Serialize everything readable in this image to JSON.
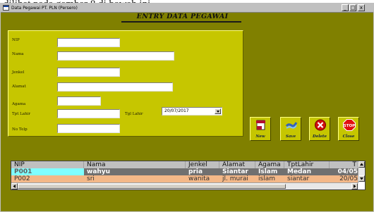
{
  "caption": "dilihat pada gambar 8 di bawah ini.",
  "window": {
    "title": "Data Pegawai PT. PLN (Persero)",
    "min_label": "_",
    "max_label": "□",
    "close_label": "x"
  },
  "form": {
    "title": "ENTRY DATA PEGAWAI",
    "labels": {
      "nip": "NIP",
      "nama": "Nama",
      "jenkel": "Jenkel",
      "alamat": "Alamat",
      "agama": "Agama",
      "tpt_lahir": "Tpt Lahir",
      "tgl_lahir": "Tgl Lahir",
      "no_telp": "No Telp"
    },
    "values": {
      "nip": "",
      "nama": "",
      "jenkel": "",
      "alamat": "",
      "agama": "",
      "tpt_lahir": "",
      "tgl_lahir": "20/07/2017",
      "no_telp": ""
    }
  },
  "toolbar": {
    "new_label": "New",
    "save_label": "Save",
    "delete_label": "Delete",
    "close_label": "Close",
    "colors": {
      "new": "#b01030",
      "save": "#3060c0",
      "delete": "#d01010",
      "close": "#e01010"
    }
  },
  "grid": {
    "columns": [
      "NIP",
      "Nama",
      "Jenkel",
      "Alamat",
      "Agama",
      "TptLahir",
      "T"
    ],
    "rows": [
      [
        "P001",
        "wahyu",
        "pria",
        "Siantar",
        "Islam",
        "Medan",
        "04/05"
      ],
      [
        "P002",
        "sri",
        "wanita",
        "jl. murai",
        "islam",
        "siantar",
        "20/05"
      ]
    ]
  },
  "colors": {
    "window_bg": "#808000",
    "panel_bg": "#c6c600",
    "selected_cell": "#80ffff",
    "selected_row": "#707070",
    "alt_row": "#f4b888"
  }
}
